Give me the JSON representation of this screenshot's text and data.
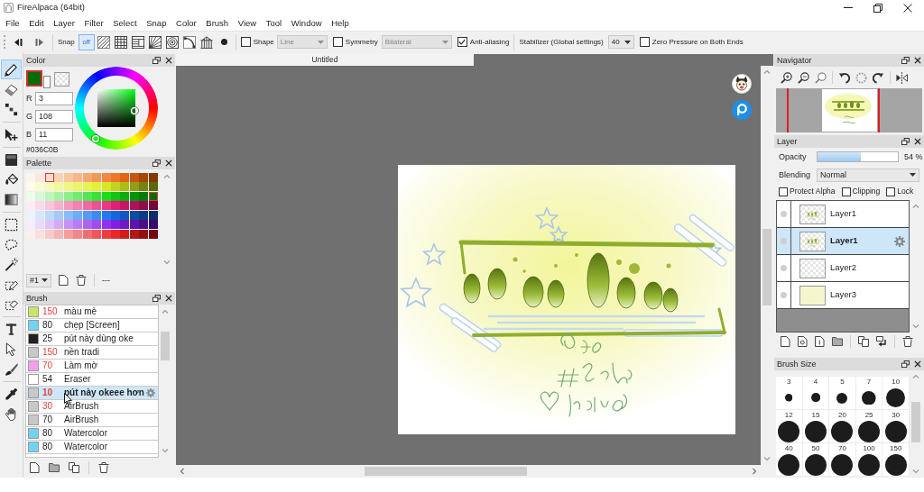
{
  "window": {
    "title": "FireAlpaca (64bit)"
  },
  "menu": [
    "File",
    "Edit",
    "Layer",
    "Filter",
    "Select",
    "Snap",
    "Color",
    "Brush",
    "View",
    "Tool",
    "Window",
    "Help"
  ],
  "toolbar": {
    "snap": {
      "label": "Snap",
      "modes": [
        {
          "kind": "off",
          "label": "off",
          "selected": true
        },
        {
          "kind": "parallel",
          "selected": false
        },
        {
          "kind": "grid",
          "selected": false
        },
        {
          "kind": "lines",
          "selected": false
        },
        {
          "kind": "radial",
          "selected": false
        },
        {
          "kind": "circle",
          "selected": false
        },
        {
          "kind": "curve",
          "selected": false
        },
        {
          "kind": "perspective",
          "selected": false
        }
      ]
    },
    "shape": {
      "label": "Shape",
      "checked": false,
      "value": "Line",
      "disabled": true
    },
    "symmetry": {
      "label": "Symmetry",
      "checked": false,
      "value": "Bilateral",
      "disabled": true
    },
    "anti_aliasing": {
      "label": "Anti-aliasing",
      "checked": true
    },
    "stabilizer": {
      "label": "Stabilizer (Global settings)",
      "value": "40"
    },
    "zero_pressure": {
      "label": "Zero Pressure on Both Ends",
      "checked": false
    }
  },
  "tool_groups": [
    [
      {
        "kind": "pen",
        "selected": true
      },
      {
        "kind": "eraser",
        "selected": false
      },
      {
        "kind": "dot",
        "selected": false
      }
    ],
    [
      {
        "kind": "move",
        "selected": false
      }
    ],
    [
      {
        "kind": "fill",
        "selected": false
      },
      {
        "kind": "bucket",
        "selected": false
      },
      {
        "kind": "gradient",
        "selected": false
      }
    ],
    [
      {
        "kind": "select",
        "selected": false
      },
      {
        "kind": "lasso",
        "selected": false
      },
      {
        "kind": "wand",
        "selected": false
      },
      {
        "kind": "selpen",
        "selected": false
      },
      {
        "kind": "selerase",
        "selected": false
      }
    ],
    [
      {
        "kind": "text",
        "selected": false
      },
      {
        "kind": "operation",
        "selected": false
      },
      {
        "kind": "blur",
        "selected": false
      }
    ],
    [
      {
        "kind": "dropper",
        "selected": false
      },
      {
        "kind": "hand",
        "selected": false
      }
    ]
  ],
  "color_panel": {
    "title": "Color",
    "swatches": [
      {
        "kind": "main",
        "color": "#036c0b",
        "selected": true
      },
      {
        "kind": "sub",
        "color": "#ffffff",
        "selected": false
      },
      {
        "kind": "transparent",
        "selected": false
      }
    ],
    "fields": [
      {
        "label": "R",
        "value": "3"
      },
      {
        "label": "G",
        "value": "108"
      },
      {
        "label": "B",
        "value": "11"
      }
    ],
    "hex": "#036C0B"
  },
  "palette_panel": {
    "title": "Palette",
    "rows": [
      [
        {
          "color": "#fdf4ee",
          "selected": false
        },
        {
          "color": "#fce9dd",
          "selected": false
        },
        {
          "color": "#fadfd0",
          "selected": true
        },
        {
          "color": "#f9d3b5",
          "selected": false
        },
        {
          "color": "#f8c7a0",
          "selected": false
        },
        {
          "color": "#f6b889",
          "selected": false
        },
        {
          "color": "#f5a872",
          "selected": false
        },
        {
          "color": "#f3985b",
          "selected": false
        },
        {
          "color": "#f18744",
          "selected": false
        },
        {
          "color": "#ee752b",
          "selected": false
        },
        {
          "color": "#e26416",
          "selected": false
        },
        {
          "color": "#c8560e",
          "selected": false
        },
        {
          "color": "#a64708",
          "selected": false
        },
        {
          "color": "#853804",
          "selected": false
        }
      ],
      [
        {
          "color": "#fbfce9",
          "selected": false
        },
        {
          "color": "#f8fbd2",
          "selected": false
        },
        {
          "color": "#f5fab9",
          "selected": false
        },
        {
          "color": "#f1f89f",
          "selected": false
        },
        {
          "color": "#eef785",
          "selected": false
        },
        {
          "color": "#eaf56b",
          "selected": false
        },
        {
          "color": "#e6f351",
          "selected": false
        },
        {
          "color": "#e2f136",
          "selected": false
        },
        {
          "color": "#d7e723",
          "selected": false
        },
        {
          "color": "#c3d31c",
          "selected": false
        },
        {
          "color": "#adbd18",
          "selected": false
        },
        {
          "color": "#939f13",
          "selected": false
        },
        {
          "color": "#78830f",
          "selected": false
        },
        {
          "color": "#5e670a",
          "selected": false
        }
      ],
      [
        {
          "color": "#edfced",
          "selected": false
        },
        {
          "color": "#d7f9d7",
          "selected": false
        },
        {
          "color": "#bff6bf",
          "selected": false
        },
        {
          "color": "#a6f3a6",
          "selected": false
        },
        {
          "color": "#8bef8b",
          "selected": false
        },
        {
          "color": "#70eb70",
          "selected": false
        },
        {
          "color": "#54e754",
          "selected": false
        },
        {
          "color": "#37e337",
          "selected": false
        },
        {
          "color": "#1cdd1c",
          "selected": false
        },
        {
          "color": "#12c413",
          "selected": false
        },
        {
          "color": "#0cab0e",
          "selected": false
        },
        {
          "color": "#07930b",
          "selected": false
        },
        {
          "color": "#057c09",
          "selected": false
        },
        {
          "color": "#036c08",
          "selected": true
        }
      ],
      [
        {
          "color": "#fcedf4",
          "selected": false
        },
        {
          "color": "#fadbe8",
          "selected": false
        },
        {
          "color": "#f8c6da",
          "selected": false
        },
        {
          "color": "#f6b0cc",
          "selected": false
        },
        {
          "color": "#f499be",
          "selected": false
        },
        {
          "color": "#f282b0",
          "selected": false
        },
        {
          "color": "#f06aa1",
          "selected": false
        },
        {
          "color": "#ee5192",
          "selected": false
        },
        {
          "color": "#ec3883",
          "selected": false
        },
        {
          "color": "#e21d74",
          "selected": false
        },
        {
          "color": "#c91766",
          "selected": false
        },
        {
          "color": "#ad1258",
          "selected": false
        },
        {
          "color": "#900d49",
          "selected": false
        },
        {
          "color": "#74083a",
          "selected": false
        }
      ],
      [
        {
          "color": "#ebf3fd",
          "selected": false
        },
        {
          "color": "#d6e7fb",
          "selected": false
        },
        {
          "color": "#bed9f9",
          "selected": false
        },
        {
          "color": "#a5caf7",
          "selected": false
        },
        {
          "color": "#8bbbf5",
          "selected": false
        },
        {
          "color": "#71abf3",
          "selected": false
        },
        {
          "color": "#579bf1",
          "selected": false
        },
        {
          "color": "#3d8bef",
          "selected": false
        },
        {
          "color": "#237aed",
          "selected": false
        },
        {
          "color": "#1668d9",
          "selected": false
        },
        {
          "color": "#1259bf",
          "selected": false
        },
        {
          "color": "#0e4ba3",
          "selected": false
        },
        {
          "color": "#0a3d87",
          "selected": false
        },
        {
          "color": "#072f6b",
          "selected": false
        }
      ],
      [
        {
          "color": "#f6edfd",
          "selected": false
        },
        {
          "color": "#ecd9fb",
          "selected": false
        },
        {
          "color": "#e0c3f9",
          "selected": false
        },
        {
          "color": "#d3abf7",
          "selected": false
        },
        {
          "color": "#c693f5",
          "selected": false
        },
        {
          "color": "#b97bf3",
          "selected": false
        },
        {
          "color": "#ac63f1",
          "selected": false
        },
        {
          "color": "#9e4bef",
          "selected": false
        },
        {
          "color": "#9033ed",
          "selected": false
        },
        {
          "color": "#7f1fe1",
          "selected": false
        },
        {
          "color": "#6d19c5",
          "selected": false
        },
        {
          "color": "#5b14a7",
          "selected": false
        },
        {
          "color": "#490f89",
          "selected": false
        },
        {
          "color": "#370a6b",
          "selected": false
        }
      ],
      [
        {
          "color": "#fdefef",
          "selected": false
        },
        {
          "color": "#fbdede",
          "selected": false
        },
        {
          "color": "#f9caca",
          "selected": false
        },
        {
          "color": "#f7b4b4",
          "selected": false
        },
        {
          "color": "#f59d9d",
          "selected": false
        },
        {
          "color": "#f38686",
          "selected": false
        },
        {
          "color": "#f16e6e",
          "selected": false
        },
        {
          "color": "#ef5656",
          "selected": false
        },
        {
          "color": "#ed3e3e",
          "selected": false
        },
        {
          "color": "#eb2626",
          "selected": false
        },
        {
          "color": "#d21c1c",
          "selected": false
        },
        {
          "color": "#b41515",
          "selected": false
        },
        {
          "color": "#960f0f",
          "selected": false
        },
        {
          "color": "#780909",
          "selected": false
        }
      ]
    ],
    "page": "#1",
    "name": "---"
  },
  "brush_panel": {
    "title": "Brush",
    "brushes": [
      {
        "color": "#c9e56a",
        "size": "150",
        "size_in_red": true,
        "name": "màu mè",
        "selected": false
      },
      {
        "color": "#6fd3f5",
        "size": "80",
        "size_in_red": false,
        "name": "chẹp [Screen]",
        "selected": false
      },
      {
        "color": "#222222",
        "size": "25",
        "size_in_red": false,
        "name": "pút này dùng oke",
        "selected": false
      },
      {
        "color": "#c8c8c8",
        "size": "150",
        "size_in_red": true,
        "name": "nền tradi",
        "selected": false
      },
      {
        "color": "#f59ef0",
        "size": "70",
        "size_in_red": true,
        "name": "Làm mờ",
        "selected": false
      },
      {
        "color": "#ffffff",
        "size": "54",
        "size_in_red": false,
        "name": "Eraser",
        "selected": false
      },
      {
        "color": "#c8c8c8",
        "size": "10",
        "size_in_red": true,
        "name": "pút này okeee hơn",
        "selected": true
      },
      {
        "color": "#c8c8c8",
        "size": "30",
        "size_in_red": true,
        "name": "AirBrush",
        "selected": false
      },
      {
        "color": "#c8c8c8",
        "size": "70",
        "size_in_red": false,
        "name": "AirBrush",
        "selected": false
      },
      {
        "color": "#6fd3f5",
        "size": "80",
        "size_in_red": false,
        "name": "Watercolor",
        "selected": false
      },
      {
        "color": "#6fd3f5",
        "size": "80",
        "size_in_red": false,
        "name": "Watercolor",
        "selected": false
      }
    ]
  },
  "document": {
    "tab": "Untitled"
  },
  "navigator": {
    "title": "Navigator"
  },
  "layer_panel": {
    "title": "Layer",
    "opacity": {
      "label": "Opacity",
      "level": 0.54,
      "reading": "54 %"
    },
    "blending": {
      "label": "Blending",
      "value": "Normal"
    },
    "options": [
      {
        "label": "Protect Alpha",
        "checked": false
      },
      {
        "label": "Clipping",
        "checked": false
      },
      {
        "label": "Lock",
        "checked": false
      }
    ],
    "layers": [
      {
        "name": "Layer1",
        "selected": false,
        "kind": "drawing"
      },
      {
        "name": "Layer1",
        "selected": true,
        "kind": "drawing"
      },
      {
        "name": "Layer2",
        "selected": false,
        "kind": "empty"
      },
      {
        "name": "Layer3",
        "selected": false,
        "kind": "fill"
      }
    ]
  },
  "brush_size_panel": {
    "title": "Brush Size",
    "sizes": [
      "3",
      "4",
      "5",
      "7",
      "10",
      "12",
      "15",
      "20",
      "25",
      "30",
      "40",
      "50",
      "70",
      "100",
      "150"
    ]
  }
}
